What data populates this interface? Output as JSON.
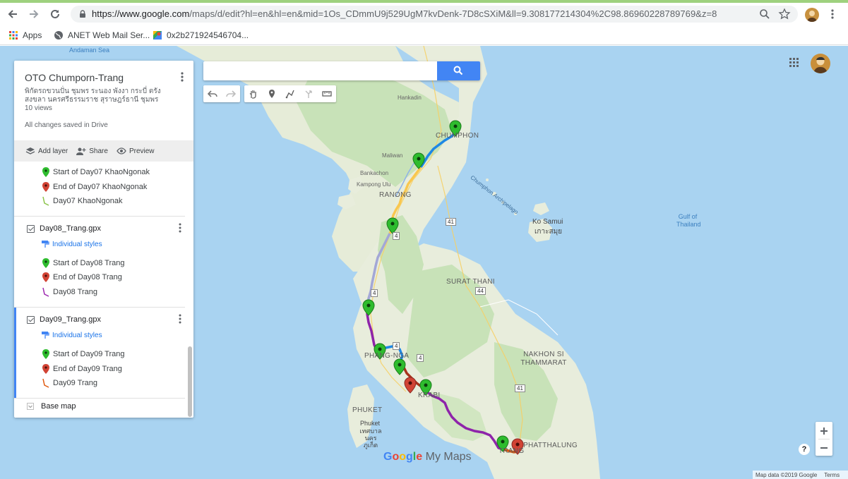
{
  "browser": {
    "url_host": "https://www.google.com",
    "url_rest": "/maps/d/edit?hl=en&hl=en&mid=1Os_CDmmU9j529UgM7kvDenk-7D8cSXiM&ll=9.308177214304%2C98.86960228789769&z=8",
    "bookmarks": [
      "Apps",
      "ANET Web Mail Ser...",
      "0x2b271924546704..."
    ]
  },
  "panel": {
    "title": "OTO Chumporn-Trang",
    "description": "พิกัดรถขวนปั่น ชุมพร ระนอง พังงา กระบี่ ตรัง สงขลา นครศรีธรรมราช สุราษฎร์ธานี ชุมพร",
    "views": "10 views",
    "save_status": "All changes saved in Drive",
    "actions": {
      "add_layer": "Add layer",
      "share": "Share",
      "preview": "Preview"
    },
    "day07": {
      "start": "Start of Day07 KhaoNgonak",
      "end": "End of Day07 KhaoNgonak",
      "route": "Day07 KhaoNgonak"
    },
    "day08": {
      "layer": "Day08_Trang.gpx",
      "style": "Individual styles",
      "start": "Start of Day08 Trang",
      "end": "End of Day08 Trang",
      "route": "Day08 Trang"
    },
    "day09": {
      "layer": "Day09_Trang.gpx",
      "style": "Individual styles",
      "start": "Start of Day09 Trang",
      "end": "End of Day09 Trang",
      "route": "Day09 Trang"
    },
    "base_map": "Base map"
  },
  "map": {
    "labels": {
      "andaman": "Andaman Sea",
      "hankadin": "Hankadin",
      "chumphon": "CHUMPHON",
      "maliwan": "Maliwan",
      "bankachon": "Bankachon",
      "kampong": "Kampong Ulu",
      "ranong": "RANONG",
      "archipelago": "Chumphon Archipelago",
      "gulf": "Gulf of Thailand",
      "kosamui": "Ko Samui",
      "kosamui_th": "เกาะสมุย",
      "surat": "SURAT THANI",
      "nakhon": "NAKHON SI THAMMARAT",
      "phangnga": "PHANG-NGA",
      "krabi": "KRABI",
      "phuket": "PHUKET",
      "phuket2": "Phuket",
      "phuket_th": "เทศบาลนครภูเก็ต",
      "phatthalung": "PHATTHALUNG",
      "trang": "TRANG"
    },
    "road_badges": [
      "4",
      "41",
      "4",
      "44",
      "4",
      "41",
      "4"
    ],
    "colors": {
      "water": "#a9d3f1",
      "land": "#e8eddc",
      "forest": "#c8e2b8",
      "route_blue": "#1e88e5",
      "route_yellow": "#f9c74f",
      "route_lavender": "#a3a7d6",
      "route_purple": "#8e24aa",
      "route_brown": "#a8321c",
      "route_orange": "#e0590f",
      "pin_green": "#2ebc2e",
      "pin_red": "#d14334"
    },
    "logo": {
      "g1": "G",
      "g2": "o",
      "g3": "o",
      "g4": "g",
      "g5": "l",
      "g6": "e",
      "my": "My Maps"
    },
    "attribution": "Map data ©2019 Google",
    "terms": "Terms",
    "help": "?"
  }
}
